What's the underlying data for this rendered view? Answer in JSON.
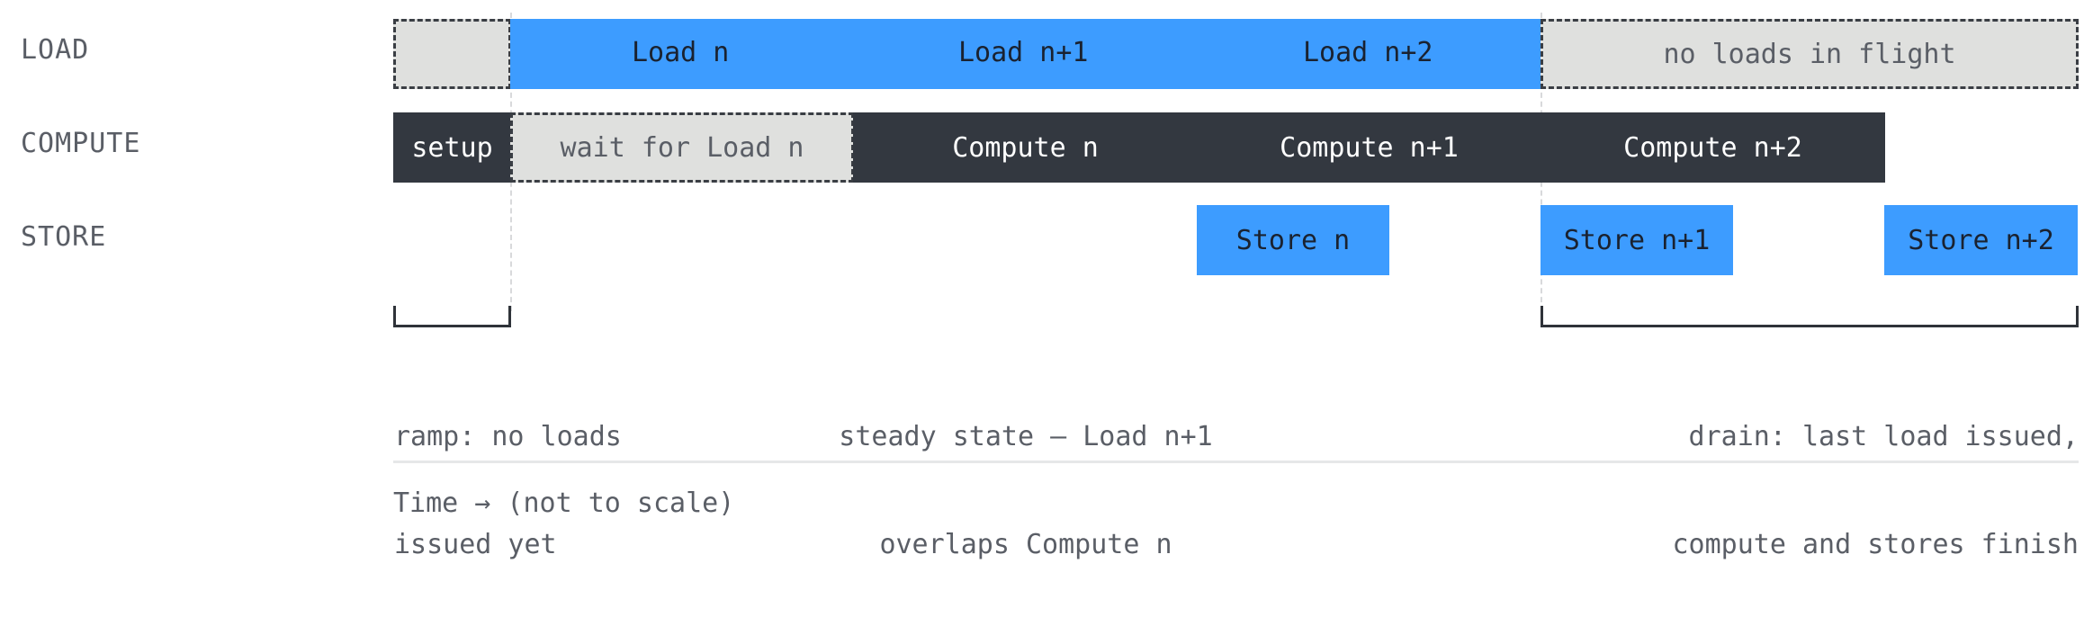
{
  "lanes": {
    "load": "LOAD",
    "compute": "COMPUTE",
    "store": "STORE"
  },
  "load_blocks": {
    "pre": "",
    "load_n": "Load n",
    "load_n1": "Load n+1",
    "load_n2": "Load n+2",
    "none": "no loads in flight"
  },
  "compute_blocks": {
    "setup": "setup",
    "wait": "wait for Load n",
    "comp_n": "Compute n",
    "comp_n1": "Compute n+1",
    "comp_n2": "Compute n+2"
  },
  "store_blocks": {
    "store_n": "Store n",
    "store_n1": "Store n+1",
    "store_n2": "Store n+2"
  },
  "phases": {
    "ramp_line1": "ramp: no loads",
    "ramp_line2": "issued yet",
    "steady_line1": "steady state — Load n+1",
    "steady_line2": "overlaps Compute n",
    "drain_line1": "drain: last load issued,",
    "drain_line2": "compute and stores finish"
  },
  "axis": {
    "caption": "Time → (not to scale)"
  },
  "colors": {
    "load_store": "#3d9cff",
    "compute": "#333840",
    "idle": "#dfe0de",
    "text": "#5a5e66"
  }
}
